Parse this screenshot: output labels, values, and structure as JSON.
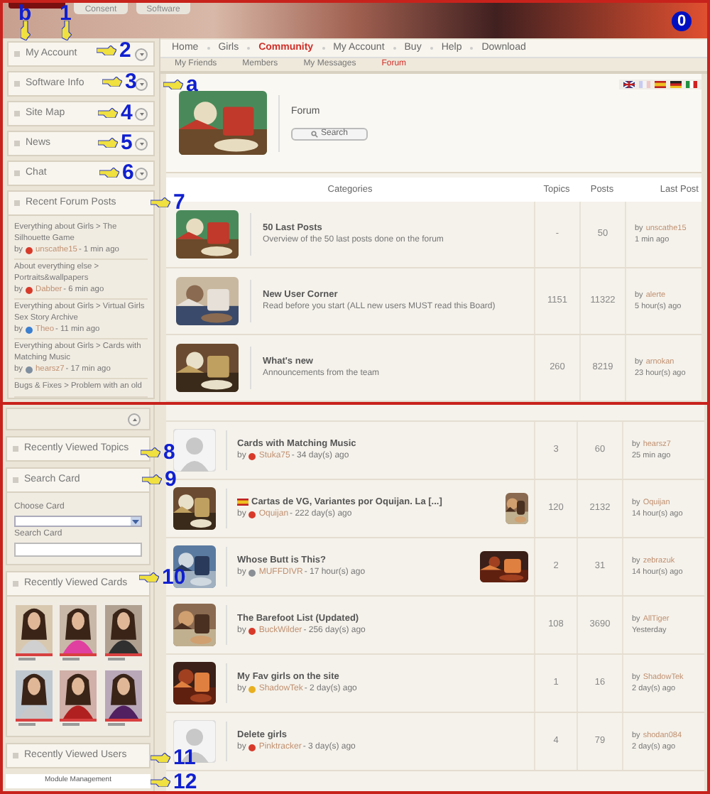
{
  "header": {
    "buttons": [
      "Consent",
      "Software"
    ]
  },
  "nav": [
    {
      "label": "Home",
      "selected": false
    },
    {
      "label": "Girls",
      "selected": false
    },
    {
      "label": "Community",
      "selected": true
    },
    {
      "label": "My Account",
      "selected": false
    },
    {
      "label": "Buy",
      "selected": false
    },
    {
      "label": "Help",
      "selected": false
    },
    {
      "label": "Download",
      "selected": false
    }
  ],
  "subnav": [
    {
      "label": "My Friends",
      "selected": false
    },
    {
      "label": "Members",
      "selected": false
    },
    {
      "label": "My Messages",
      "selected": false
    },
    {
      "label": "Forum",
      "selected": true
    }
  ],
  "forum_panel": {
    "title": "Forum",
    "search_button": "Search"
  },
  "sidebar_modules": [
    {
      "title": "My Account",
      "expanded": false
    },
    {
      "title": "Software Info",
      "expanded": false
    },
    {
      "title": "Site Map",
      "expanded": false
    },
    {
      "title": "News",
      "expanded": false
    },
    {
      "title": "Chat",
      "expanded": false
    },
    {
      "title": "Recent Forum Posts",
      "expanded": true
    }
  ],
  "recent_posts": [
    {
      "topic": "Everything about Girls > The Silhouette Game",
      "by": "by",
      "author": "unscathe15",
      "color": "#d83a2a",
      "time": "- 1 min ago"
    },
    {
      "topic": "About everything else > Portraits&wallpapers",
      "by": "by",
      "author": "Dabber",
      "color": "#d83a2a",
      "time": "- 6 min ago"
    },
    {
      "topic": "Everything about Girls > Virtual Girls Sex Story Archive",
      "by": "by",
      "author": "Theo",
      "color": "#3a7fd0",
      "time": "- 11 min ago"
    },
    {
      "topic": "Everything about Girls > Cards with Matching Music",
      "by": "by",
      "author": "hearsz7",
      "color": "#7f8fa0",
      "time": "- 17 min ago"
    },
    {
      "topic": "Bugs & Fixes > Problem with an old"
    }
  ],
  "categories_table": {
    "columns": [
      "Categories",
      "Topics",
      "Posts",
      "Last Post"
    ],
    "rows": [
      {
        "title": "50 Last Posts",
        "description": "Overview of the 50 last posts done on the forum",
        "topics": "-",
        "posts": "50",
        "last_by": "by",
        "last_author": "unscathe15",
        "last_time": "1 min ago"
      },
      {
        "title": "New User Corner",
        "description": "Read before you start (ALL new users MUST read this Board)",
        "topics": "1151",
        "posts": "11322",
        "last_by": "by",
        "last_author": "alerte",
        "last_time": "5 hour(s) ago"
      },
      {
        "title": "What's new",
        "description": "Announcements from the team",
        "topics": "260",
        "posts": "8219",
        "last_by": "by",
        "last_author": "arnokan",
        "last_time": "23 hour(s) ago"
      }
    ]
  },
  "sidebar_bottom": {
    "collapse_button": true,
    "modules": [
      {
        "title": "Recently Viewed Topics"
      },
      {
        "title": "Search Card",
        "kind": "search"
      },
      {
        "title": "Recently Viewed Cards",
        "kind": "cards"
      },
      {
        "title": "Recently Viewed Users"
      }
    ],
    "search_card": {
      "choose_label": "Choose Card",
      "search_label": "Search Card"
    },
    "footer_link": "Module Management"
  },
  "topics": [
    {
      "kind": "placeholder",
      "flag": false,
      "title": "Cards with Matching Music",
      "by": "by",
      "author": "Stuka75",
      "color": "#d83a2a",
      "time": "- 34 day(s) ago",
      "thumbnail": false,
      "topics": "3",
      "posts": "60",
      "last_by": "by",
      "last_author": "hearsz7",
      "last_time": "25 min ago"
    },
    {
      "kind": "picture",
      "flag": true,
      "title": "Cartas de VG, Variantes por Oquijan. La [...]",
      "by": "by",
      "author": "Oquijan",
      "color": "#d83a2a",
      "time": "- 222 day(s) ago",
      "thumbnail": true,
      "topics": "120",
      "posts": "2132",
      "last_by": "by",
      "last_author": "Oquijan",
      "last_time": "14 hour(s) ago"
    },
    {
      "kind": "picture",
      "flag": false,
      "title": "Whose Butt is This?",
      "by": "by",
      "author": "MUFFDIVR",
      "color": "#8a8f96",
      "time": "- 17 hour(s) ago",
      "thumbnail": true,
      "topics": "2",
      "posts": "31",
      "last_by": "by",
      "last_author": "zebrazuk",
      "last_time": "14 hour(s) ago"
    },
    {
      "kind": "picture",
      "flag": false,
      "title": "The Barefoot List (Updated)",
      "by": "by",
      "author": "BuckWilder",
      "color": "#d83a2a",
      "time": "- 256 day(s) ago",
      "thumbnail": false,
      "topics": "108",
      "posts": "3690",
      "last_by": "by",
      "last_author": "AllTiger",
      "last_time": "Yesterday"
    },
    {
      "kind": "picture",
      "flag": false,
      "title": "My Fav girls on the site",
      "by": "by",
      "author": "ShadowTek",
      "color": "#e8b020",
      "time": "- 2 day(s) ago",
      "thumbnail": false,
      "topics": "1",
      "posts": "16",
      "last_by": "by",
      "last_author": "ShadowTek",
      "last_time": "2 day(s) ago"
    },
    {
      "kind": "placeholder",
      "flag": false,
      "title": "Delete girls",
      "by": "by",
      "author": "Pinktracker",
      "color": "#d83a2a",
      "time": "- 3 day(s) ago",
      "thumbnail": false,
      "topics": "4",
      "posts": "79",
      "last_by": "by",
      "last_author": "shodan084",
      "last_time": "2 day(s) ago"
    }
  ],
  "annotations": [
    "b",
    "1",
    "2",
    "3",
    "a",
    "4",
    "5",
    "6",
    "7",
    "0",
    "8",
    "9",
    "10",
    "11",
    "12"
  ]
}
